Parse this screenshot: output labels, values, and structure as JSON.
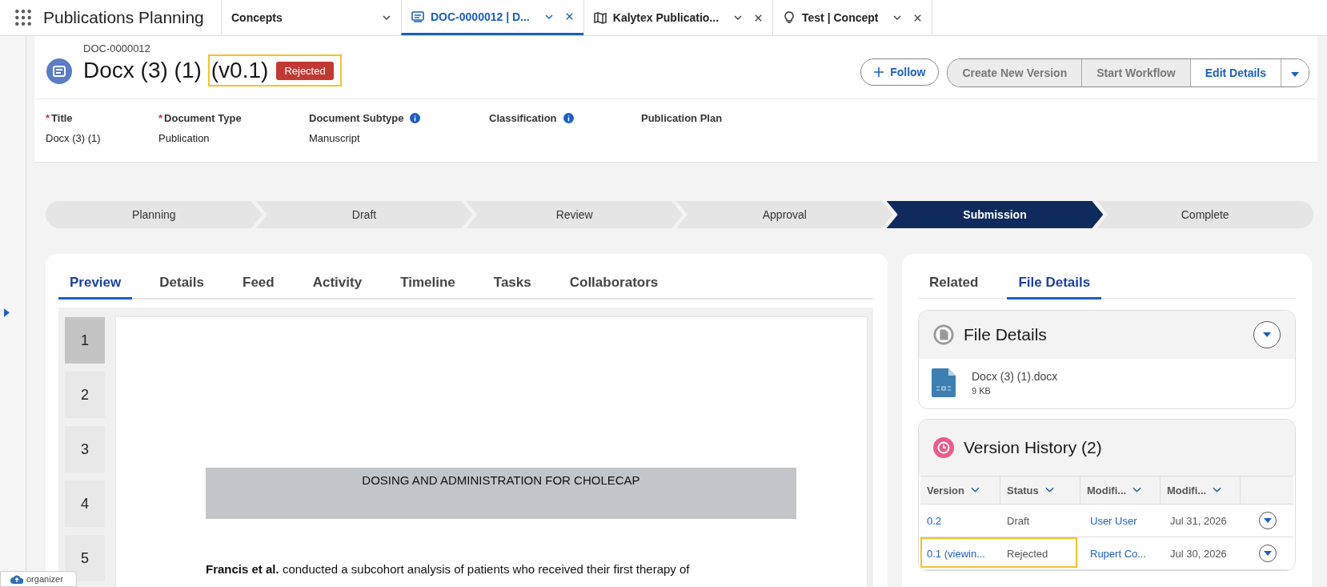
{
  "app": {
    "name": "Publications Planning"
  },
  "tabs": [
    {
      "label": "Concepts",
      "kind": "plain",
      "selected": false,
      "closable": false
    },
    {
      "label": "DOC-0000012 | D...",
      "kind": "document",
      "selected": true,
      "closable": true
    },
    {
      "label": "Kalytex Publicatio...",
      "kind": "plan",
      "selected": false,
      "closable": true
    },
    {
      "label": "Test | Concept",
      "kind": "concept",
      "selected": false,
      "closable": true
    }
  ],
  "record": {
    "id": "DOC-0000012",
    "title": "Docx (3) (1)",
    "version": "(v0.1)",
    "status": "Rejected",
    "highlighted": true
  },
  "actions": {
    "follow": "Follow",
    "group": [
      "Create New Version",
      "Start Workflow",
      "Edit Details"
    ]
  },
  "fields": [
    {
      "label": "Title",
      "required_mark": "*",
      "info": false,
      "value": "Docx (3) (1)"
    },
    {
      "label": "Document Type",
      "required_mark": "*",
      "info": false,
      "value": "Publication"
    },
    {
      "label": "Document Subtype",
      "info": true,
      "value": "Manuscript"
    },
    {
      "label": "Classification",
      "info": true
    },
    {
      "label": "Publication Plan",
      "info": false
    }
  ],
  "path": [
    {
      "label": "Planning",
      "selected": false
    },
    {
      "label": "Draft",
      "selected": false
    },
    {
      "label": "Review",
      "selected": false
    },
    {
      "label": "Approval",
      "selected": false
    },
    {
      "label": "Submission",
      "selected": true
    },
    {
      "label": "Complete",
      "selected": false
    }
  ],
  "main_tabs": [
    {
      "label": "Preview",
      "selected": true
    },
    {
      "label": "Details",
      "selected": false
    },
    {
      "label": "Feed",
      "selected": false
    },
    {
      "label": "Activity",
      "selected": false
    },
    {
      "label": "Timeline",
      "selected": false
    },
    {
      "label": "Tasks",
      "selected": false
    },
    {
      "label": "Collaborators",
      "selected": false
    }
  ],
  "preview": {
    "pages": [
      {
        "label": "1",
        "selected": true
      },
      {
        "label": "2",
        "selected": false
      },
      {
        "label": "3",
        "selected": false
      },
      {
        "label": "4",
        "selected": false
      },
      {
        "label": "5",
        "selected": false
      }
    ],
    "heading": "DOSING AND ADMINISTRATION FOR CHOLECAP",
    "paragraph": "**Francis et al.** conducted a subcohort analysis of patients who received their first therapy of"
  },
  "side_tabs": [
    {
      "label": "Related",
      "selected": false
    },
    {
      "label": "File Details",
      "selected": true
    }
  ],
  "file_details": {
    "title": "File Details",
    "file_name": "Docx (3) (1).docx",
    "file_size": "9 KB"
  },
  "version_history": {
    "title": "Version History (2)",
    "columns": [
      "Version",
      "Status",
      "Modifi...",
      "Modifi..."
    ],
    "rows": [
      {
        "version": "0.2",
        "status": "Draft",
        "modified_by": "User User",
        "modified": "Jul 31, 2026",
        "highlighted": false
      },
      {
        "version": "0.1 (viewin...",
        "status": "Rejected",
        "modified_by": "Rupert Co...",
        "modified": "Jul 30, 2026",
        "highlighted": true
      }
    ]
  },
  "organizer": {
    "label": "organizer"
  }
}
